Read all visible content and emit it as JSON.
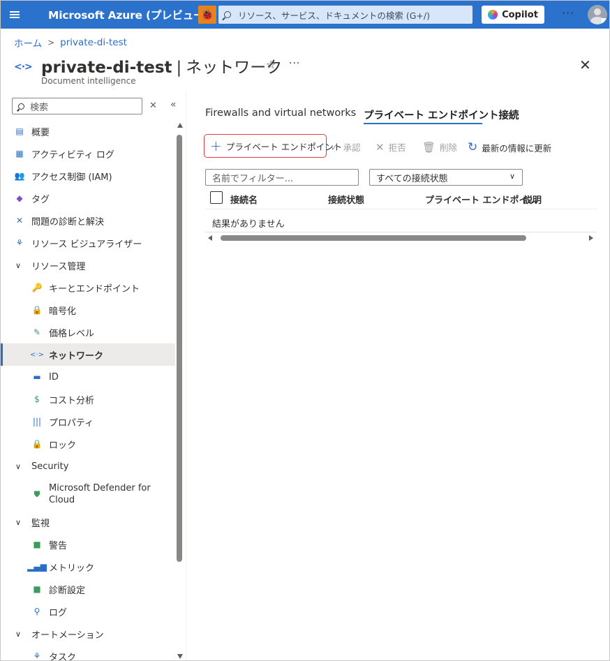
{
  "topbar": {
    "brand": "Microsoft Azure (プレビュー)",
    "search_placeholder": "リソース、サービス、ドキュメントの検索 (G+/)",
    "copilot_label": "Copilot",
    "more": "···"
  },
  "breadcrumb": {
    "home": "ホーム",
    "sep": ">",
    "resource": "private-di-test"
  },
  "header": {
    "resource": "private-di-test",
    "sep": "|",
    "page": "ネットワーク",
    "subtitle": "Document intelligence",
    "star": "☆",
    "more": "···",
    "close": "✕"
  },
  "sidebar": {
    "search_placeholder": "検索",
    "clear": "✕",
    "collapse": "«",
    "items": [
      {
        "label": "概要",
        "icon": "overview-icon"
      },
      {
        "label": "アクティビティ ログ",
        "icon": "activity-log-icon"
      },
      {
        "label": "アクセス制御 (IAM)",
        "icon": "iam-icon"
      },
      {
        "label": "タグ",
        "icon": "tag-icon"
      },
      {
        "label": "問題の診断と解決",
        "icon": "diagnose-icon"
      },
      {
        "label": "リソース ビジュアライザー",
        "icon": "visualizer-icon"
      },
      {
        "label": "リソース管理",
        "group": true
      },
      {
        "label": "キーとエンドポイント",
        "icon": "key-icon"
      },
      {
        "label": "暗号化",
        "icon": "lock-icon"
      },
      {
        "label": "価格レベル",
        "icon": "pricing-icon"
      },
      {
        "label": "ネットワーク",
        "icon": "network-icon",
        "active": true
      },
      {
        "label": "ID",
        "icon": "identity-icon"
      },
      {
        "label": "コスト分析",
        "icon": "cost-icon"
      },
      {
        "label": "プロパティ",
        "icon": "properties-icon"
      },
      {
        "label": "ロック",
        "icon": "lock-resource-icon"
      },
      {
        "label": "Security",
        "group": true
      },
      {
        "label": "Microsoft Defender for Cloud",
        "icon": "defender-icon"
      },
      {
        "label": "監視",
        "group": true
      },
      {
        "label": "警告",
        "icon": "alert-icon"
      },
      {
        "label": "メトリック",
        "icon": "metrics-icon"
      },
      {
        "label": "診断設定",
        "icon": "diagnostic-settings-icon"
      },
      {
        "label": "ログ",
        "icon": "logs-icon"
      },
      {
        "label": "オートメーション",
        "group": true
      },
      {
        "label": "タスク",
        "icon": "tasks-icon"
      }
    ]
  },
  "tabs": [
    {
      "label": "Firewalls and virtual networks"
    },
    {
      "label": "プライベート エンドポイント接続",
      "active": true
    }
  ],
  "toolbar": {
    "add": "プライベート エンドポイント",
    "approve": "承認",
    "reject": "拒否",
    "delete": "削除",
    "refresh": "最新の情報に更新"
  },
  "filters": {
    "name_placeholder": "名前でフィルター...",
    "status_value": "すべての接続状態"
  },
  "table": {
    "columns": [
      "接続名",
      "接続状態",
      "プライベート エンドポイ…",
      "説明"
    ],
    "empty": "結果がありません"
  },
  "colors": {
    "topbar": "#2b72cc",
    "accent": "#2b6ec6",
    "highlight": "#e33b3b"
  }
}
